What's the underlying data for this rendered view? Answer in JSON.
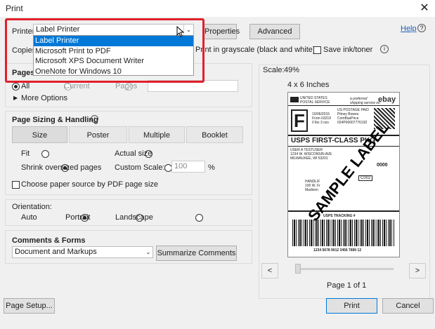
{
  "window": {
    "title": "Print",
    "close_glyph": "✕"
  },
  "printer": {
    "label": "Printer:",
    "selected": "Label Printer",
    "options": [
      "Label Printer",
      "Microsoft Print to PDF",
      "Microsoft XPS Document Writer",
      "OneNote for Windows 10"
    ]
  },
  "header_buttons": {
    "properties": "Properties",
    "advanced": "Advanced",
    "help": "Help"
  },
  "copies": {
    "label": "Copies",
    "grayscale": "Print in grayscale (black and white)",
    "save_ink": "Save ink/toner"
  },
  "pages": {
    "title": "Pages",
    "all": "All",
    "current": "Current",
    "pages": "Pages",
    "more_options": "More Options"
  },
  "sizing": {
    "title": "Page Sizing & Handling",
    "tabs": [
      "Size",
      "Poster",
      "Multiple",
      "Booklet"
    ],
    "fit": "Fit",
    "actual_size": "Actual size",
    "shrink": "Shrink oversized pages",
    "custom_scale": "Custom Scale:",
    "custom_scale_value": "100",
    "percent": "%",
    "paper_source": "Choose paper source by PDF page size"
  },
  "orientation": {
    "title": "Orientation:",
    "auto": "Auto",
    "portrait": "Portrait",
    "landscape": "Landscape"
  },
  "comments": {
    "title": "Comments & Forms",
    "selected": "Document and Markups",
    "summarize": "Summarize Comments"
  },
  "preview": {
    "scale_label": "Scale:",
    "scale_value": "49%",
    "paper_size": "4 x 6 Inches",
    "page_indicator": "Page 1 of 1",
    "prev": "<",
    "next": ">"
  },
  "label": {
    "postal": "UNITED STATES\nPOSTAL SERVICE",
    "ebay_pref": "a preferred\nshipping service on",
    "ebay": "ebay",
    "class_letter": "F",
    "date_block": "10/06/2015\nFrom 03219\n0 lbs 3 ozs",
    "postage": "US POSTAGE PAID\nPitney Bowes\nComBasPrice\n024P00007776192",
    "service": "USPS FIRST-CLASS PKG",
    "from": "USER A TESTUSER\n1234 W. WISCONSIN AVE\nMILWAUKEE, WI 53201",
    "code0000": "0000",
    "c002": "C002",
    "ship_to": "HANDLIF\n100 W. Fr\nMadison",
    "sample": "SAMPLE LABEL",
    "tracking": "USPS TRACKING #",
    "tracking_number": "1234 5678 9012 3456 7890 12"
  },
  "footer": {
    "page_setup": "Page Setup...",
    "print": "Print",
    "cancel": "Cancel"
  },
  "colors": {
    "accent": "#0078d7",
    "highlight_box": "#e0202b",
    "link": "#1a5fb4"
  }
}
